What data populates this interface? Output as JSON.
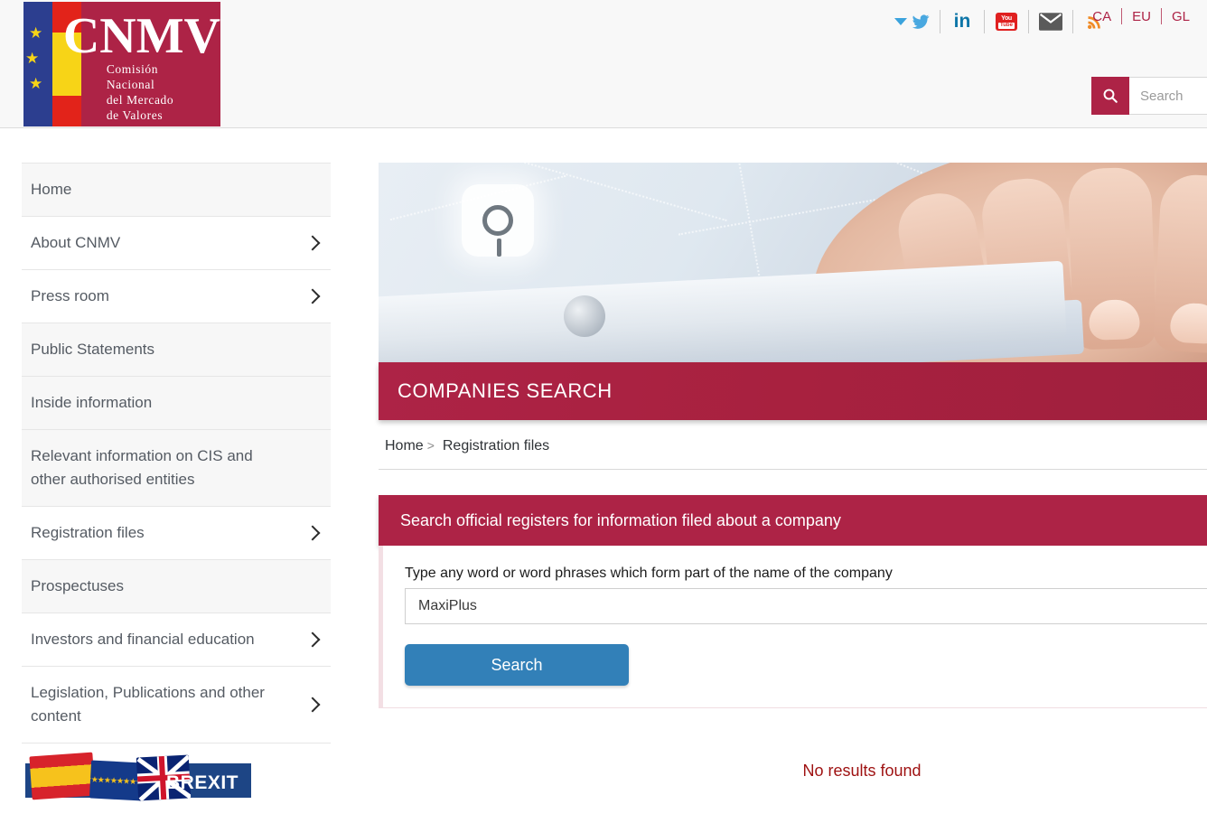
{
  "header": {
    "logo": {
      "title": "CNMV",
      "subtitle_lines": [
        "Comisión",
        "Nacional",
        "del Mercado",
        "de Valores"
      ],
      "alt": "CNMV Comisión Nacional del Mercado de Valores"
    },
    "social": [
      {
        "name": "twitter-dropdown-icon",
        "label": "Twitter"
      },
      {
        "name": "linkedin-icon",
        "label": "in"
      },
      {
        "name": "youtube-icon",
        "label": "You",
        "sub": "Tube"
      },
      {
        "name": "email-icon",
        "label": "Email"
      },
      {
        "name": "rss-icon",
        "label": "RSS"
      }
    ],
    "languages": [
      "CA",
      "EU",
      "GL"
    ],
    "search": {
      "placeholder": "Search",
      "value": "",
      "button_icon": "search-icon"
    }
  },
  "sidebar": {
    "items": [
      {
        "label": "Home",
        "has_chevron": false,
        "shaded": true
      },
      {
        "label": "About CNMV",
        "has_chevron": true,
        "shaded": false
      },
      {
        "label": "Press room",
        "has_chevron": true,
        "shaded": false
      },
      {
        "label": "Public Statements",
        "has_chevron": false,
        "shaded": true
      },
      {
        "label": "Inside information",
        "has_chevron": false,
        "shaded": true
      },
      {
        "label": "Relevant information on CIS and other authorised entities",
        "has_chevron": false,
        "shaded": true
      },
      {
        "label": "Registration files",
        "has_chevron": true,
        "shaded": false
      },
      {
        "label": "Prospectuses",
        "has_chevron": false,
        "shaded": true
      },
      {
        "label": "Investors and financial education",
        "has_chevron": true,
        "shaded": false
      },
      {
        "label": "Legislation, Publications and other content",
        "has_chevron": true,
        "shaded": false
      }
    ],
    "brexit_banner": {
      "label": "BREXIT",
      "flags": [
        "spain-flag",
        "eu-flag",
        "uk-flag"
      ]
    }
  },
  "main": {
    "hero": {
      "alt": "Hands typing on a keyboard with magnifier icon overlay",
      "icon": "magnifier-icon"
    },
    "banner_title": "COMPANIES SEARCH",
    "breadcrumb": {
      "home": "Home",
      "separator": ">",
      "current": "Registration files"
    },
    "search_panel": {
      "heading": "Search official registers for information filed about a company",
      "field_label": "Type any word or word phrases which form part of the name of the company",
      "field_value": "MaxiPlus",
      "field_placeholder": "",
      "button_label": "Search"
    },
    "results_message": "No results found"
  },
  "colors": {
    "crimson": "#ad2346",
    "button_blue": "#3280b8",
    "results_red": "#9e1111",
    "panel_border_pink": "#f3dfe4",
    "sidebar_shaded": "#f7f7f7"
  }
}
